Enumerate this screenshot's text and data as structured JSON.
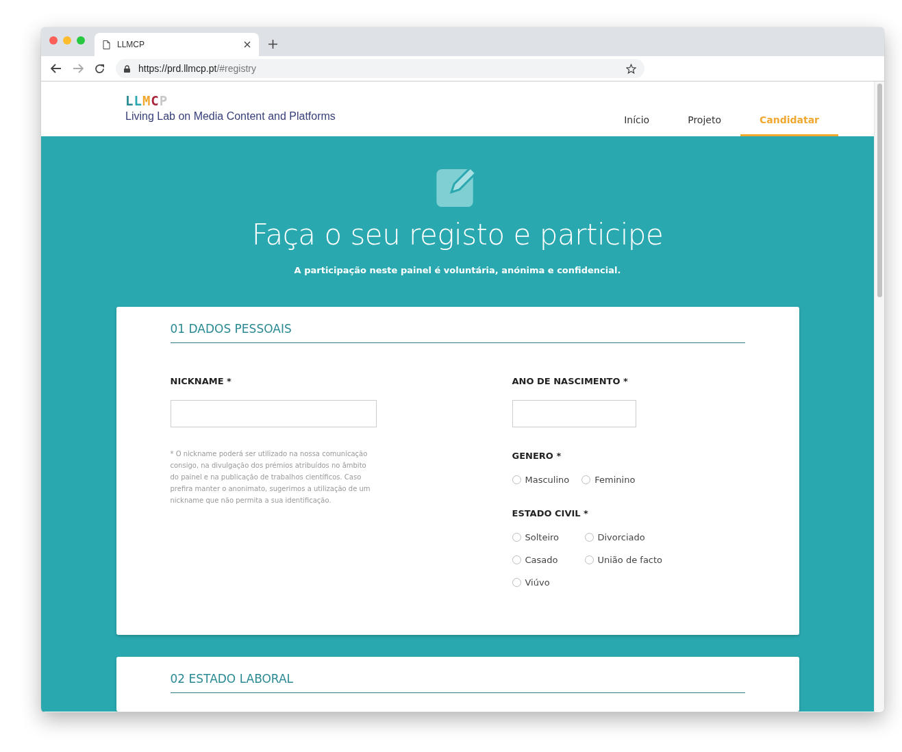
{
  "browser": {
    "tab_title": "LLMCP",
    "url_host": "https://prd.llmcp.pt",
    "url_path": "/#registry"
  },
  "site": {
    "logo": "LLMCP",
    "tagline": "Living Lab on Media Content and Platforms",
    "nav": [
      {
        "label": "Início",
        "selected": false
      },
      {
        "label": "Projeto",
        "selected": false
      },
      {
        "label": "Candidatar",
        "selected": true
      }
    ]
  },
  "hero": {
    "title": "Faça o seu registo e participe",
    "subtitle": "A participação neste painel é voluntária, anónima e confidencial."
  },
  "sections": [
    {
      "heading": "01 DADOS PESSOAIS",
      "nickname": {
        "label": "NICKNAME *",
        "note": "* O nickname poderá ser utilizado na nossa comunicação consigo, na divulgação dos prémios atribuídos no âmbito do painel e na publicação de trabalhos científicos. Caso prefira manter o anonimato, sugerimos a utilização de um nickname que não permita a sua identificação."
      },
      "birth_year": {
        "label": "ANO DE NASCIMENTO *"
      },
      "gender": {
        "label": "GENERO *",
        "options": [
          {
            "label": "Masculino",
            "selected": false
          },
          {
            "label": "Feminino",
            "selected": false
          }
        ]
      },
      "marital_status": {
        "label": "ESTADO CIVIL *",
        "options": [
          {
            "label": "Solteiro",
            "selected": false
          },
          {
            "label": "Divorciado",
            "selected": false
          },
          {
            "label": "Casado",
            "selected": false
          },
          {
            "label": "União de facto",
            "selected": false
          },
          {
            "label": "Viúvo",
            "selected": false
          }
        ]
      }
    },
    {
      "heading": "02 ESTADO LABORAL"
    }
  ]
}
